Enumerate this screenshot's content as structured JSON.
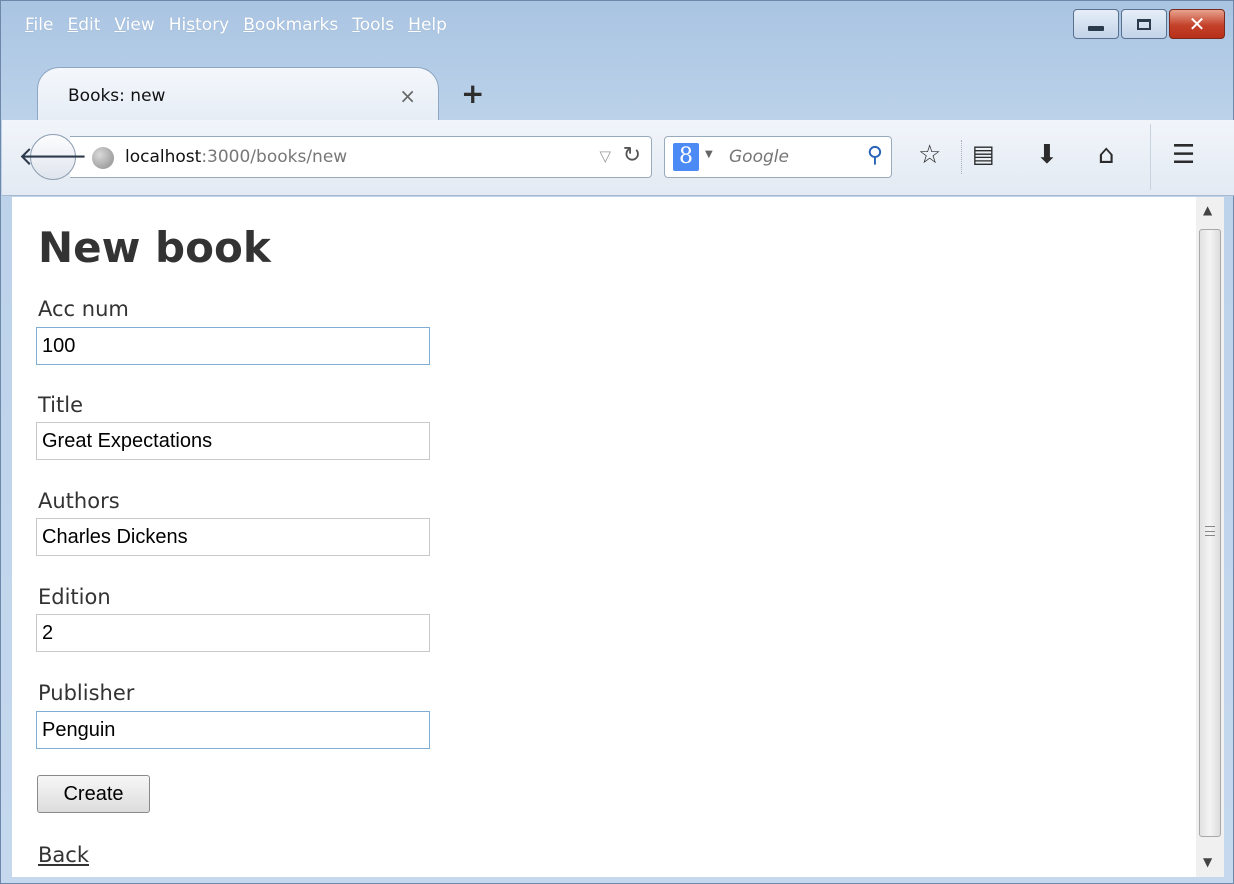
{
  "menu": {
    "items": [
      {
        "first": "F",
        "rest": "ile"
      },
      {
        "first": "E",
        "rest": "dit"
      },
      {
        "first": "V",
        "rest": "iew"
      },
      {
        "pre": "Hi",
        "first": "s",
        "rest": "tory"
      },
      {
        "first": "B",
        "rest": "ookmarks"
      },
      {
        "first": "T",
        "rest": "ools"
      },
      {
        "first": "H",
        "rest": "elp"
      }
    ]
  },
  "tab": {
    "title": "Books: new",
    "close_glyph": "×",
    "new_tab_glyph": "+"
  },
  "nav": {
    "url_host": "localhost",
    "url_rest": ":3000/books/new",
    "search_engine_letter": "8",
    "search_placeholder": "Google"
  },
  "icons": {
    "back": "arrow-left-icon",
    "site": "globe-icon",
    "dropdown": "triangle-down-icon",
    "reload": "reload-icon",
    "search_go": "magnifier-icon",
    "bookmark": "star-icon",
    "reading_list": "clipboard-icon",
    "downloads": "download-arrow-icon",
    "home": "home-icon",
    "menu": "hamburger-menu-icon"
  },
  "page": {
    "title": "New book",
    "fields": [
      {
        "label": "Acc num",
        "value": "100"
      },
      {
        "label": "Title",
        "value": "Great Expectations"
      },
      {
        "label": "Authors",
        "value": "Charles Dickens"
      },
      {
        "label": "Edition",
        "value": "2"
      },
      {
        "label": "Publisher",
        "value": "Penguin"
      }
    ],
    "submit_label": "Create",
    "back_link": "Back"
  },
  "colors": {
    "window_frame": "#b9d1ea",
    "close_button": "#c4412a",
    "text": "#333333",
    "focus_border": "#7eaed6"
  }
}
